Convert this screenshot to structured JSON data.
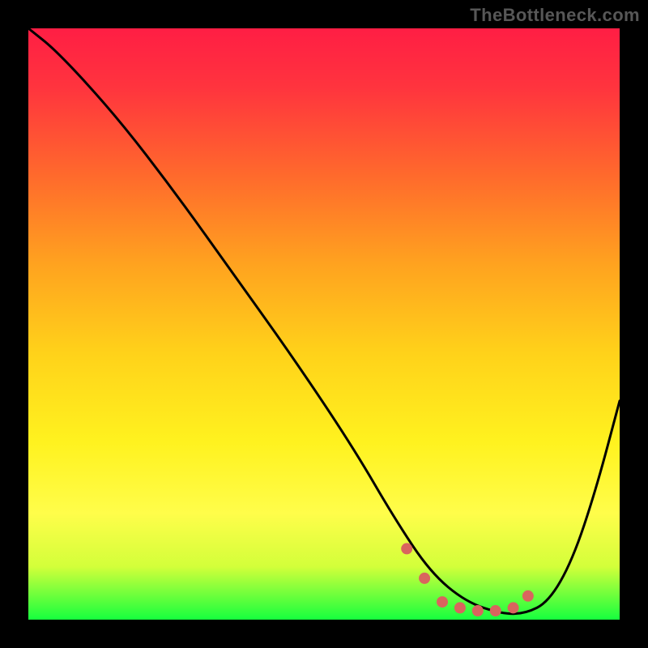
{
  "watermark": "TheBottleneck.com",
  "colors": {
    "background": "#000000",
    "gradient_top": "#ff1e44",
    "gradient_bottom": "#16ff3e",
    "curve": "#000000",
    "marker": "#d9645e"
  },
  "chart_data": {
    "type": "line",
    "title": "",
    "xlabel": "",
    "ylabel": "",
    "x_range": [
      0,
      100
    ],
    "y_range": [
      0,
      100
    ],
    "series": [
      {
        "name": "curve",
        "x": [
          0,
          5,
          15,
          25,
          35,
          45,
          55,
          62,
          68,
          74,
          80,
          84,
          88,
          92,
          96,
          100
        ],
        "y": [
          100,
          96,
          85,
          72,
          58,
          44,
          29,
          17,
          8,
          3,
          1,
          1,
          3,
          10,
          22,
          37
        ]
      }
    ],
    "markers": {
      "name": "highlight-dots",
      "x": [
        64,
        67,
        70,
        73,
        76,
        79,
        82,
        84.5
      ],
      "y": [
        12,
        7,
        3,
        2,
        1.5,
        1.5,
        2,
        4
      ]
    }
  }
}
